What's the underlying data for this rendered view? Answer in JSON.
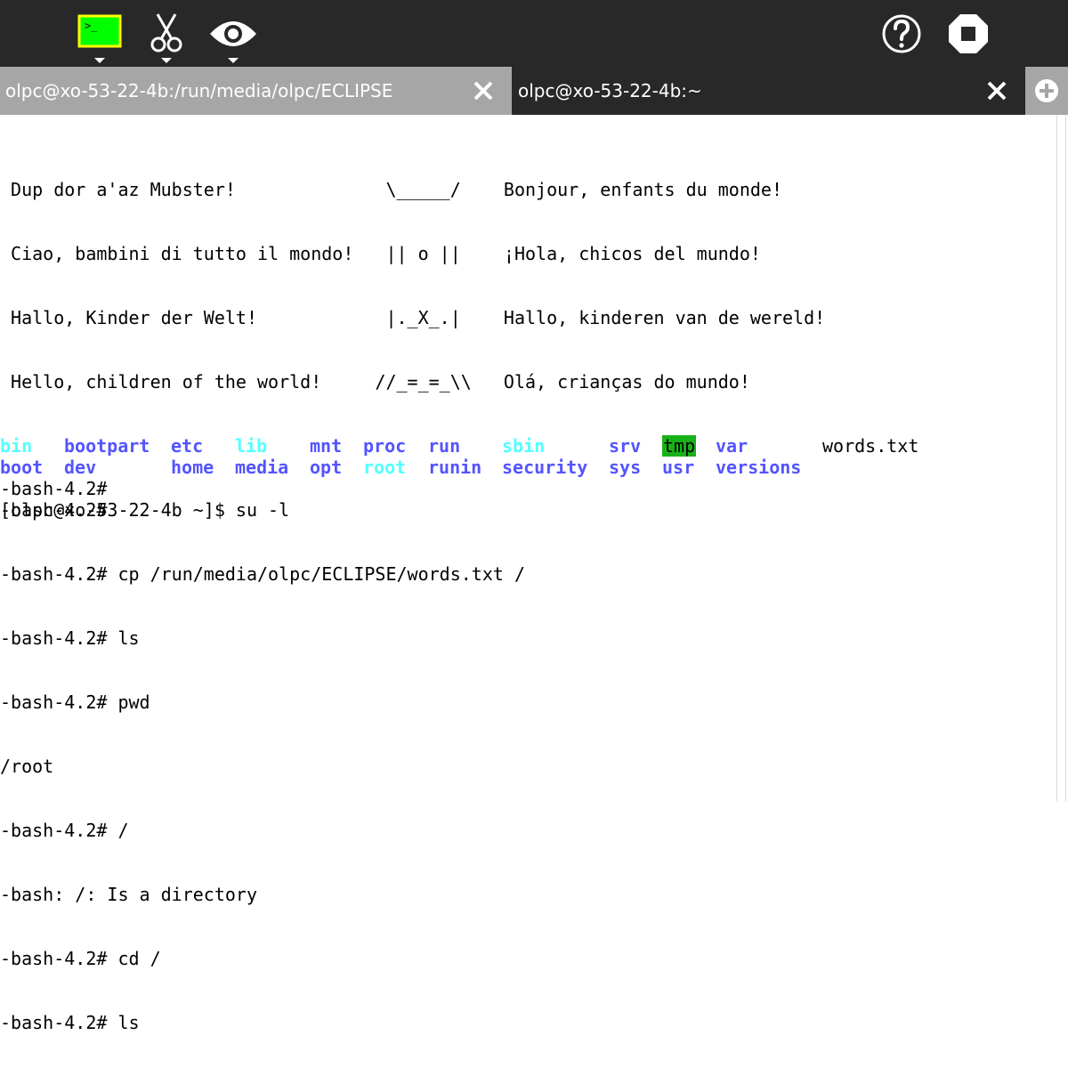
{
  "toolbar": {
    "terminal_icon": "activity-terminal-icon",
    "edit_icon": "edit-scissors-icon",
    "view_icon": "view-eye-icon",
    "help_icon": "help-icon",
    "stop_icon": "stop-icon"
  },
  "tabs": [
    {
      "label": "olpc@xo-53-22-4b:/run/media/olpc/ECLIPSE",
      "active": false
    },
    {
      "label": "olpc@xo-53-22-4b:~",
      "active": true
    }
  ],
  "terminal": {
    "lines": [
      " Dup dor a'az Mubster!              \\_____/    Bonjour, enfants du monde!",
      " Ciao, bambini di tutto il mondo!   || o ||    ¡Hola, chicos del mundo!",
      " Hallo, Kinder der Welt!            |._X_.|    Hallo, kinderen van de wereld!",
      " Hello, children of the world!     //_=_=_\\\\   Olá, crianças do mundo!",
      "",
      "[olpc@xo-53-22-4b ~]$ su -l",
      "-bash-4.2# cp /run/media/olpc/ECLIPSE/words.txt /",
      "-bash-4.2# ls",
      "-bash-4.2# pwd",
      "/root",
      "-bash-4.2# /",
      "-bash: /: Is a directory",
      "-bash-4.2# cd /",
      "-bash-4.2# ls"
    ],
    "listing": {
      "row1": [
        "bin",
        "bootpart",
        "etc",
        "lib",
        "mnt",
        "proc",
        "run",
        "sbin",
        "srv",
        "tmp",
        "var",
        "words.txt"
      ],
      "row2": [
        "boot",
        "dev",
        "home",
        "media",
        "opt",
        "root",
        "runin",
        "security",
        "sys",
        "usr",
        "versions"
      ]
    },
    "after": [
      "-bash-4.2#",
      "-bash-4.2#"
    ]
  },
  "colors": {
    "toolbar_bg": "#282828",
    "inactive_tab_bg": "#a6a6a6",
    "dir_blue": "#5454ff",
    "link_cyan": "#54ffff",
    "tmp_highlight": "#18b218",
    "terminal_icon_green": "#00ff00",
    "terminal_icon_border": "#ffff00"
  }
}
